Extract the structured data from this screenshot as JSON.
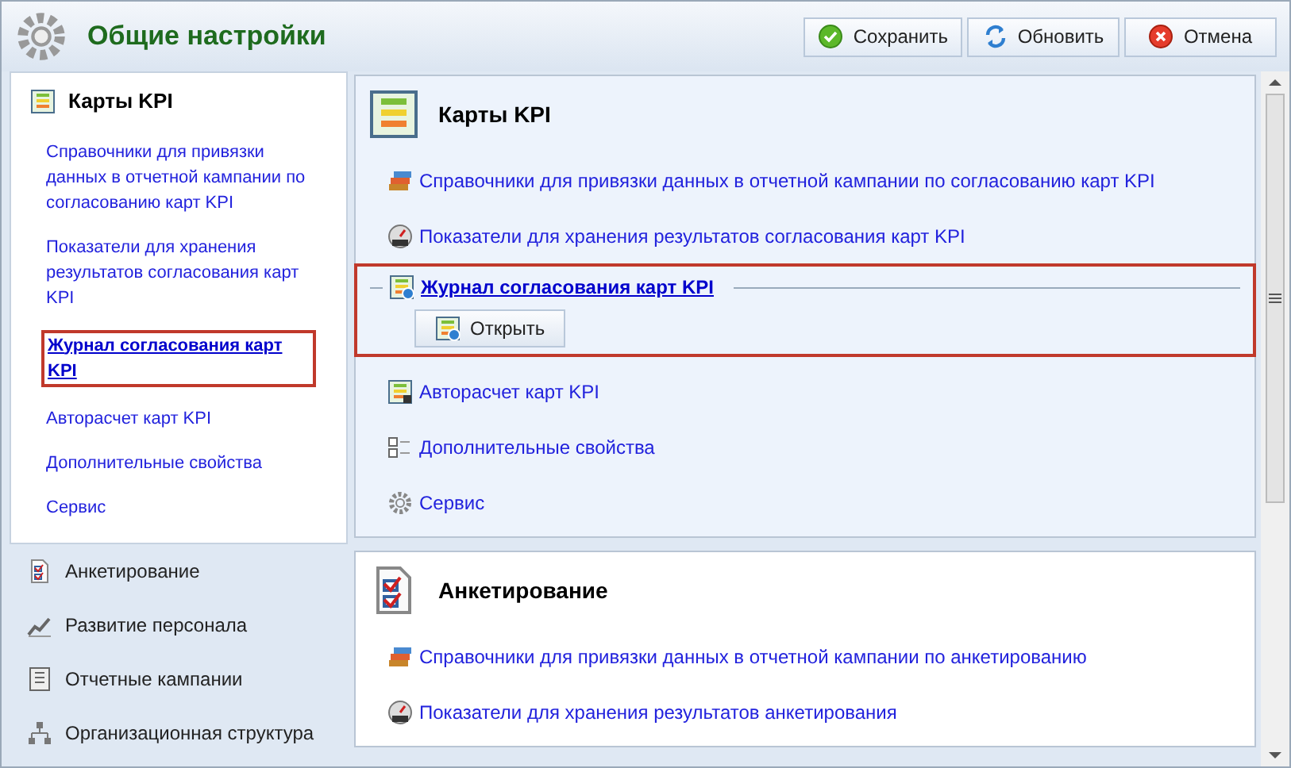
{
  "header": {
    "title": "Общие настройки",
    "buttons": [
      {
        "label": "Сохранить",
        "kind": "save"
      },
      {
        "label": "Обновить",
        "kind": "refresh"
      },
      {
        "label": "Отмена",
        "kind": "cancel"
      }
    ]
  },
  "sidebar": {
    "groups": [
      {
        "title": "Карты KPI",
        "kind": "kpi",
        "expanded": true,
        "items": [
          {
            "label": "Справочники для привязки данных в отчетной кампании по согласованию карт KPI",
            "selected": false
          },
          {
            "label": "Показатели для хранения результатов согласования карт KPI",
            "selected": false
          },
          {
            "label": "Журнал согласования карт KPI",
            "selected": true
          },
          {
            "label": "Авторасчет карт KPI",
            "selected": false
          },
          {
            "label": "Дополнительные свойства",
            "selected": false
          },
          {
            "label": "Сервис",
            "selected": false
          }
        ]
      },
      {
        "title": "Анкетирование",
        "kind": "survey",
        "expanded": false
      },
      {
        "title": "Развитие персонала",
        "kind": "growth",
        "expanded": false
      },
      {
        "title": "Отчетные кампании",
        "kind": "campaign",
        "expanded": false
      },
      {
        "title": "Организационная структура",
        "kind": "org",
        "expanded": false
      }
    ]
  },
  "sections": [
    {
      "title": "Карты KPI",
      "kind": "kpi",
      "items": [
        {
          "label": "Справочники для привязки данных в отчетной кампании по согласованию карт KPI",
          "kind": "books",
          "expanded": false
        },
        {
          "label": "Показатели для хранения результатов согласования карт KPI",
          "kind": "gauge",
          "expanded": false
        },
        {
          "label": "Журнал согласования карт KPI",
          "kind": "journal",
          "expanded": true,
          "button": "Открыть"
        },
        {
          "label": "Авторасчет карт KPI",
          "kind": "calc",
          "expanded": false
        },
        {
          "label": "Дополнительные свойства",
          "kind": "props",
          "expanded": false
        },
        {
          "label": "Сервис",
          "kind": "gear",
          "expanded": false
        }
      ]
    },
    {
      "title": "Анкетирование",
      "kind": "survey",
      "items": [
        {
          "label": "Справочники для привязки данных в отчетной кампании по анкетированию",
          "kind": "books",
          "expanded": false
        },
        {
          "label": "Показатели для хранения результатов анкетирования",
          "kind": "gauge",
          "expanded": false
        }
      ]
    }
  ]
}
